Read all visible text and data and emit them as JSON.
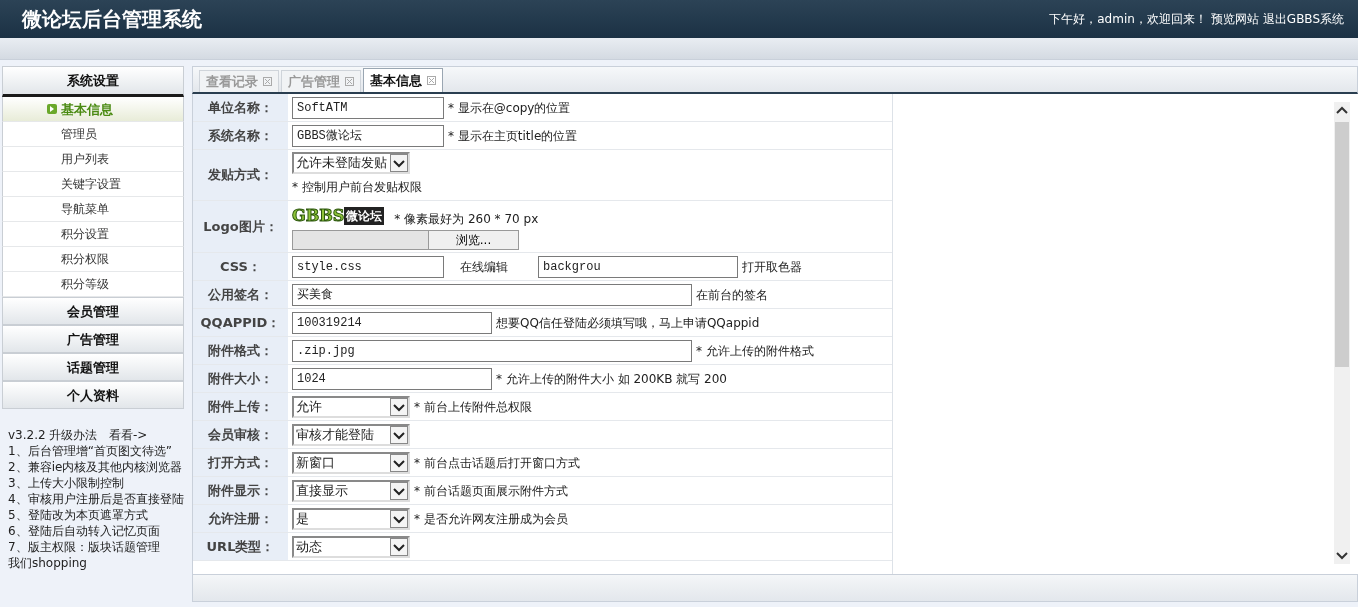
{
  "header": {
    "title": "微论坛后台管理系统",
    "greeting": "下午好，admin，欢迎回来！",
    "links": [
      "预览网站",
      "退出GBBS系统"
    ]
  },
  "sidebar": {
    "groups": [
      {
        "title": "系统设置",
        "expanded": true,
        "items": [
          {
            "label": "基本信息",
            "selected": true
          },
          {
            "label": "管理员",
            "selected": false
          },
          {
            "label": "用户列表",
            "selected": false
          },
          {
            "label": "关键字设置",
            "selected": false
          },
          {
            "label": "导航菜单",
            "selected": false
          },
          {
            "label": "积分设置",
            "selected": false
          },
          {
            "label": "积分权限",
            "selected": false
          },
          {
            "label": "积分等级",
            "selected": false
          }
        ]
      },
      {
        "title": "会员管理",
        "expanded": false
      },
      {
        "title": "广告管理",
        "expanded": false
      },
      {
        "title": "话题管理",
        "expanded": false
      },
      {
        "title": "个人资料",
        "expanded": false
      }
    ],
    "notes_title": "v3.2.2 升级办法",
    "notes_link": "看看->",
    "notes": [
      "1、后台管理增“首页图文待选”",
      "2、兼容ie内核及其他内核浏览器",
      "3、上传大小限制控制",
      "4、审核用户注册后是否直接登陆",
      "5、登陆改为本页遮罩方式",
      "6、登陆后自动转入记忆页面",
      "7、版主权限：版块话题管理",
      "我们shopping"
    ]
  },
  "tabs": [
    {
      "label": "查看记录",
      "selected": false
    },
    {
      "label": "广告管理",
      "selected": false
    },
    {
      "label": "基本信息",
      "selected": true
    }
  ],
  "form": [
    {
      "kind": "text",
      "label": "单位名称：",
      "value": "SoftATM",
      "hint": "* 显示在@copy的位置"
    },
    {
      "kind": "text",
      "label": "系统名称：",
      "value": "GBBS微论坛",
      "hint": "* 显示在主页title的位置"
    },
    {
      "kind": "selectblock",
      "label": "发贴方式：",
      "value": "允许未登陆发贴",
      "hint": "* 控制用户前台发贴权限"
    },
    {
      "kind": "logo",
      "label": "Logo图片：",
      "logo": [
        "GBBS",
        "微论坛"
      ],
      "hint": "* 像素最好为  260 * 70 px",
      "button": "浏览..."
    },
    {
      "kind": "css",
      "label": "CSS：",
      "value": "style.css",
      "link": "在线编辑",
      "value2": "backgrou",
      "hint": "打开取色器"
    },
    {
      "kind": "wide",
      "label": "公用签名：",
      "value": "买美食",
      "hint": "在前台的签名"
    },
    {
      "kind": "medium",
      "label": "QQAPPID：",
      "value": "100319214",
      "hint": "想要QQ信任登陆必须填写哦，马上申请QQappid"
    },
    {
      "kind": "wide",
      "label": "附件格式：",
      "value": ".zip.jpg",
      "hint": "* 允许上传的附件格式"
    },
    {
      "kind": "medium",
      "label": "附件大小：",
      "value": "1024",
      "hint": "* 允许上传的附件大小  如  200KB 就写  200"
    },
    {
      "kind": "select",
      "label": "附件上传：",
      "value": "允许",
      "hint": "* 前台上传附件总权限"
    },
    {
      "kind": "select",
      "label": "会员审核：",
      "value": "审核才能登陆"
    },
    {
      "kind": "select",
      "label": "打开方式：",
      "value": "新窗口",
      "hint": "* 前台点击话题后打开窗口方式"
    },
    {
      "kind": "select",
      "label": "附件显示：",
      "value": "直接显示",
      "hint": "* 前台话题页面展示附件方式"
    },
    {
      "kind": "select",
      "label": "允许注册：",
      "value": "是",
      "hint": "* 是否允许网友注册成为会员"
    },
    {
      "kind": "select",
      "label": "URL类型：",
      "value": "动态"
    }
  ]
}
